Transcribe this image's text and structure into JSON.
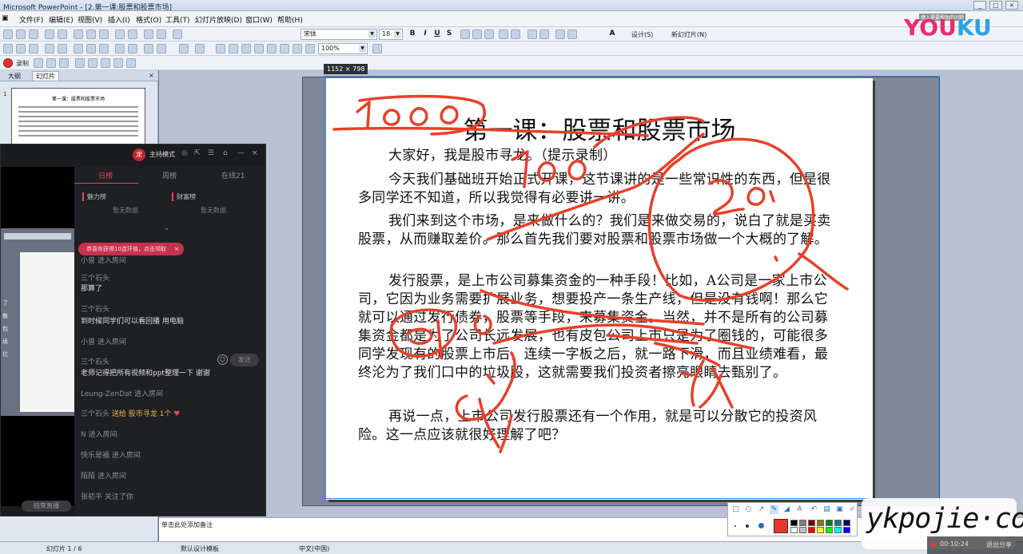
{
  "window": {
    "title": "Microsoft PowerPoint - [2.第一课:股票和股票市场]"
  },
  "menu": [
    "文件(F)",
    "编辑(E)",
    "视图(V)",
    "插入(I)",
    "格式(O)",
    "工具(T)",
    "幻灯片放映(D)",
    "窗口(W)",
    "帮助(H)"
  ],
  "toolbar": {
    "font_name": "宋体",
    "font_size": "18",
    "design_label": "设计(S)",
    "new_slide_label": "新幻灯片(N)",
    "zoom": "100%",
    "record_label": "录制"
  },
  "youku": {
    "logo_left": "YOU",
    "logo_right": "KU",
    "sub": "键入需要帮助的问题"
  },
  "outline": {
    "tabs": [
      "大纲",
      "幻灯片"
    ],
    "slide_number": "1",
    "thumb_title": "第一课：股票和股票市场"
  },
  "slide": {
    "dimension_label": "1152 × 798",
    "title": "第一课：股票和股票市场",
    "paragraphs": [
      "大家好，我是股市寻龙。（提示录制）",
      "今天我们基础班开始正式开课，这节课讲的是一些常识性的东西，但是很多同学还不知道，所以我觉得有必要讲一讲。",
      "我们来到这个市场，是来做什么的？我们是来做交易的，说白了就是买卖股票，从而赚取差价。那么首先我们要对股票和股票市场做一个大概的了解。",
      "发行股票，是上市公司募集资金的一种手段！比如，A公司是一家上市公司，它因为业务需要扩展业务，想要投产一条生产线，但是没有钱啊！那么它就可以通过发行债券，股票等手段，来募集资金。当然，并不是所有的公司募集资金都是为了公司长远发展，也有皮包公司上市只是为了圈钱的，可能很多同学发现有的股票上市后，连续一字板之后，就一路下滑，而且业绩难看，最终沦为了我们口中的垃圾股，这就需要我们投资者擦亮眼睛去甄别了。",
      "再说一点，上市公司发行股票还有一个作用，就是可以分散它的投资风险。这一点应该就很好理解了吧？"
    ]
  },
  "notes": {
    "placeholder": "单击此处添加备注"
  },
  "status": {
    "slide_of": "幻灯片 1 / 6",
    "template": "默认设计模板",
    "language": "中文(中国)"
  },
  "live": {
    "mode": "主持模式",
    "avatar_glyph": "龙",
    "tabs": [
      "日榜",
      "周榜",
      "在线21"
    ],
    "rank_left": "魅力榜",
    "rank_right": "财富榜",
    "empty_left": "暂无数据",
    "empty_right": "暂无数据",
    "toast": "恭喜你获得10连环值，点击领取",
    "messages": [
      {
        "who": "小曾",
        "text": "进入房间",
        "white": false
      },
      {
        "who": "三个石头",
        "text": "",
        "white": false
      },
      {
        "who": "",
        "text": "那算了",
        "white": true
      },
      {
        "who": "三个石头",
        "text": "",
        "white": false
      },
      {
        "who": "",
        "text": "到时候同学们可以看回播 用电脑",
        "white": true
      },
      {
        "who": "小曾",
        "text": "进入房间",
        "white": false
      },
      {
        "who": "三个石头",
        "text": "",
        "white": false
      },
      {
        "who": "",
        "text": "老师记得把所有视频和ppt整理一下 谢谢",
        "white": true
      },
      {
        "who": "Leung-ZenDat",
        "text": "进入房间",
        "white": false
      },
      {
        "who": "三个石头",
        "text": "送给 股市寻龙 1个",
        "white": false,
        "gift": true
      },
      {
        "who": "N",
        "text": "进入房间",
        "white": false
      },
      {
        "who": "快乐是福",
        "text": "进入房间",
        "white": false
      },
      {
        "who": "陌陌",
        "text": "进入房间",
        "white": false
      },
      {
        "who": "张初平",
        "text": "关注了你",
        "white": false
      }
    ],
    "end_label": "结束直播",
    "send_label": "发送",
    "screen_chars": [
      "了",
      "散",
      "包",
      "续",
      "垃"
    ]
  },
  "watermark": "ykpojie·com",
  "video": {
    "time": "00:10:24",
    "exit": "退出分享"
  },
  "colors": {
    "ink": "#e8402a",
    "accent": "#e8455a",
    "selection": "#3a8be6"
  }
}
